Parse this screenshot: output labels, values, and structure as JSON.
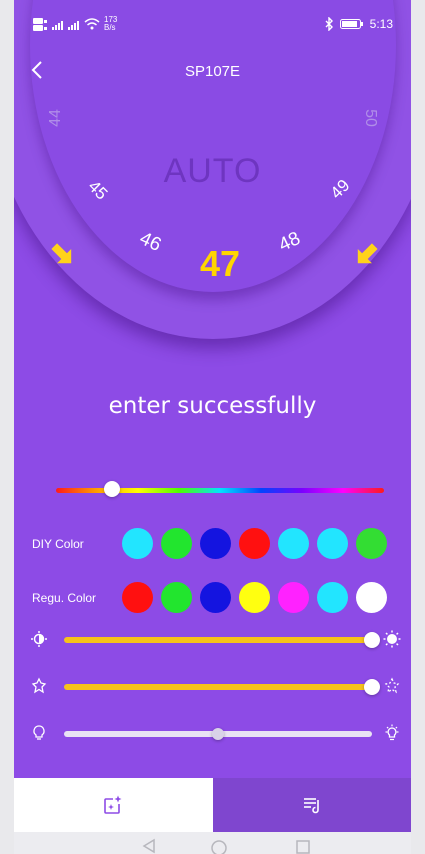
{
  "status_bar": {
    "network_left": "4G",
    "speed_value": "173",
    "speed_unit": "B/s",
    "battery": "82",
    "time": "5:13"
  },
  "header": {
    "title": "SP107E"
  },
  "dial": {
    "mode_text": "AUTO",
    "numbers": [
      "44",
      "45",
      "46",
      "47",
      "48",
      "49",
      "50"
    ],
    "selected": "47"
  },
  "message": "enter successfully",
  "hue_slider": {
    "position": 0.17
  },
  "diy_color": {
    "label": "DIY Color",
    "colors": [
      "#22e5ff",
      "#22e52e",
      "#1414e0",
      "#ff1010",
      "#22e5ff",
      "#22e5ff",
      "#33dd33"
    ]
  },
  "regu_color": {
    "label": "Regu. Color",
    "colors": [
      "#ff1010",
      "#22e52e",
      "#1414e0",
      "#ffff10",
      "#ff22ff",
      "#22e5ff",
      "#ffffff"
    ]
  },
  "brightness_slider": {
    "value": 1.0
  },
  "speed_slider": {
    "value": 1.0
  },
  "white_slider": {
    "value": 0.5
  },
  "colors": {
    "background": "#8d4be6",
    "accent": "#f7c21b",
    "selected_number": "#ffd500"
  },
  "tabs": [
    {
      "name": "effects-tab",
      "icon": "sparkle-image-icon",
      "active": true
    },
    {
      "name": "music-tab",
      "icon": "music-list-icon",
      "active": false
    }
  ]
}
